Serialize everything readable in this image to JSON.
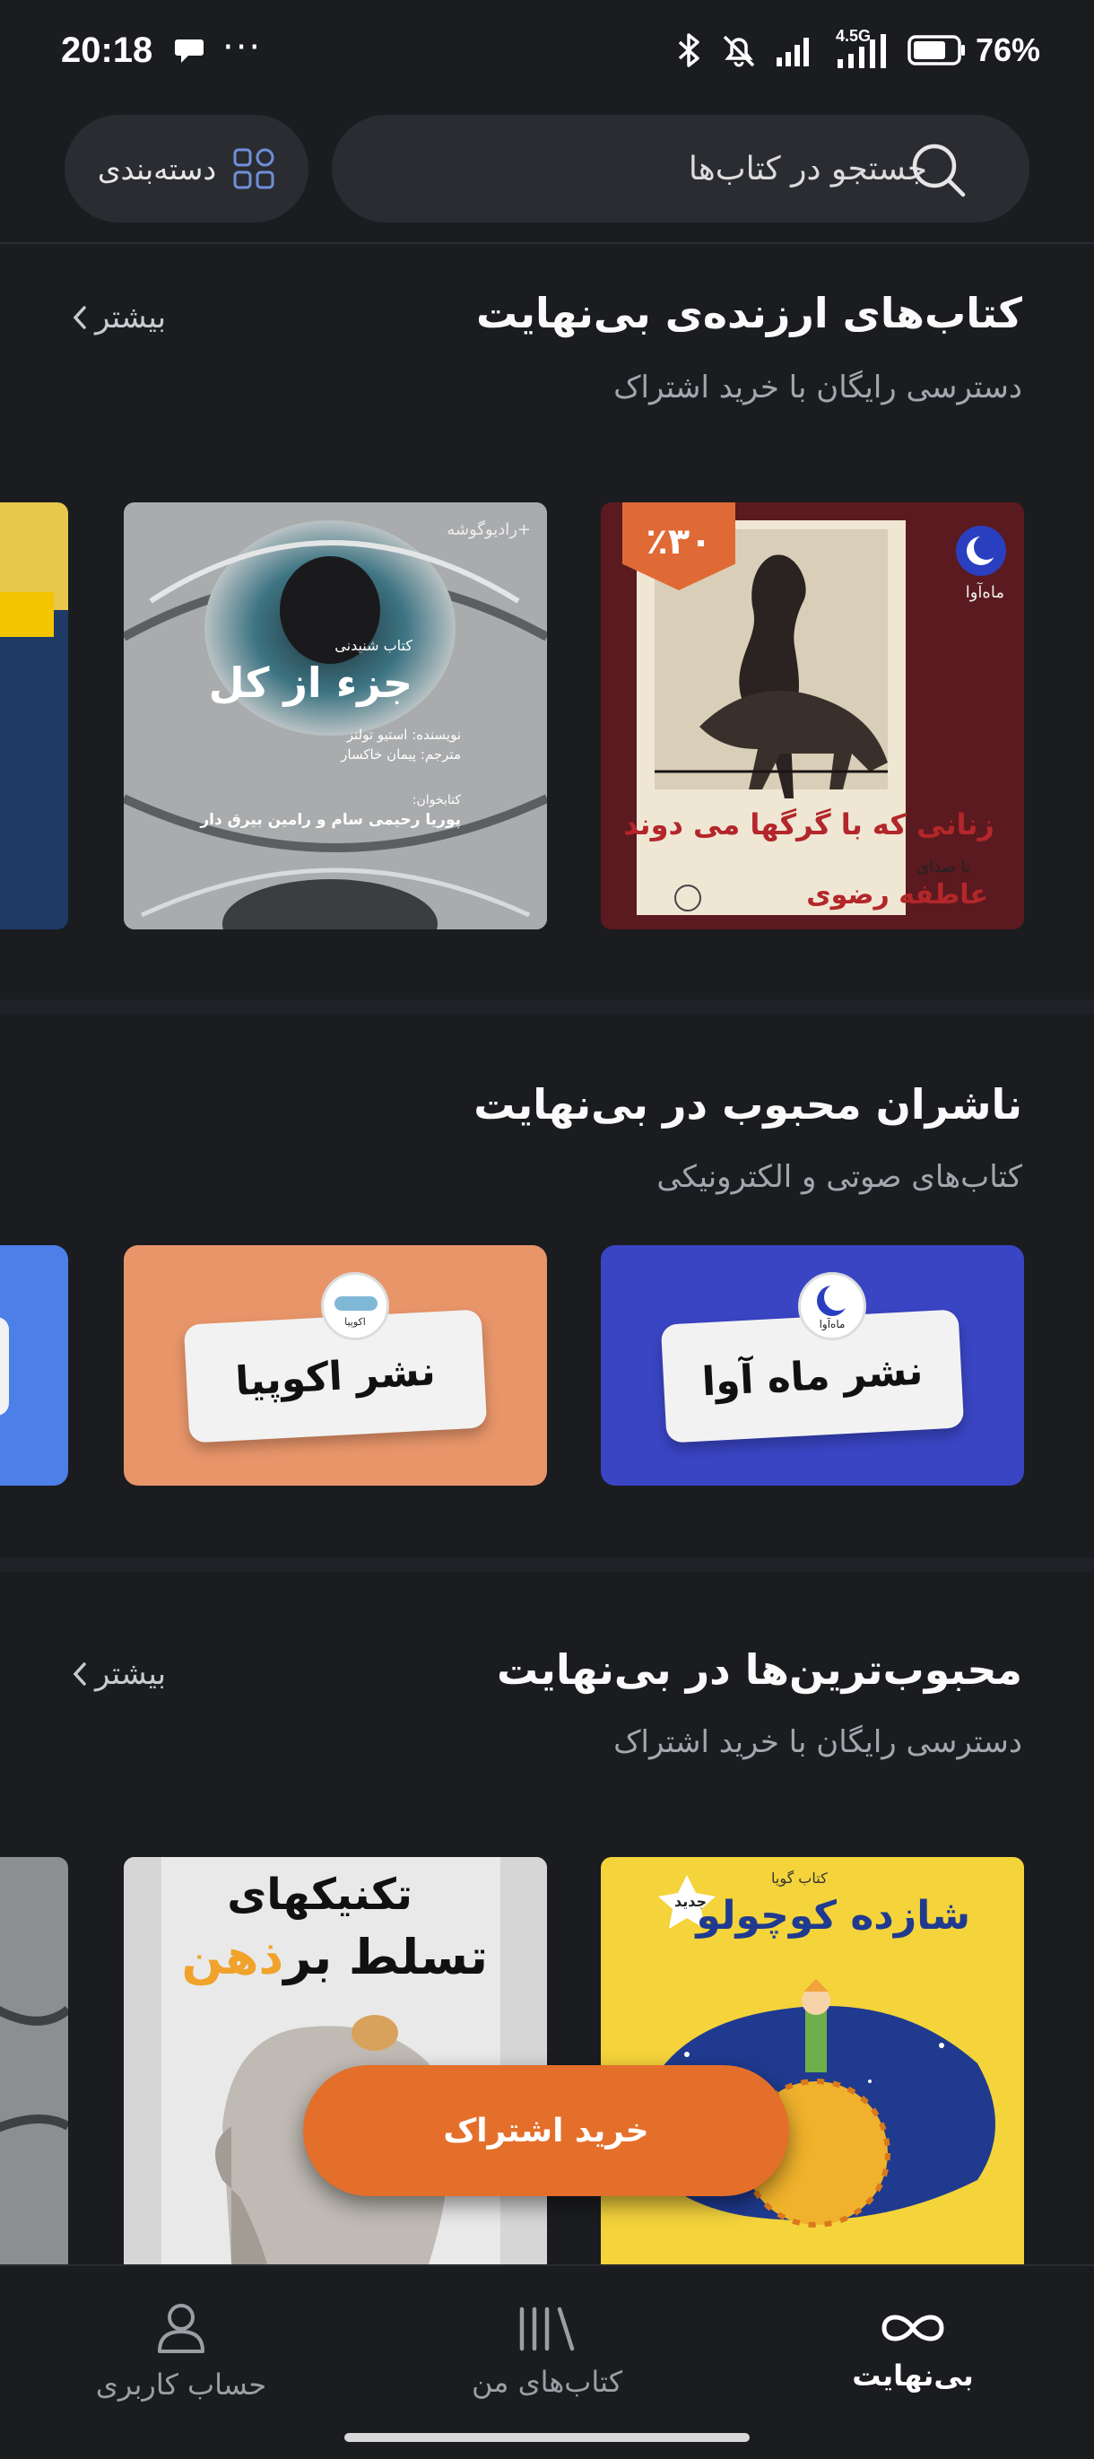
{
  "status_bar": {
    "time": "20:18",
    "dots": "···",
    "network": "4.5G",
    "battery_percent": "76%",
    "battery_level": 0.76
  },
  "header": {
    "search_placeholder": "جستجو در کتاب‌ها",
    "category_label": "دسته‌بندی"
  },
  "sections": [
    {
      "title": "کتاب‌های ارزنده‌ی بی‌نهایت",
      "subtitle": "دسترسی رایگان با خرید اشتراک",
      "more_label": "بیشتر",
      "books": [
        {
          "cover_title": "زنانی که با گرگها می دوند",
          "voice_label": "با صدای",
          "narrator": "عاطفه رضوی",
          "discount_badge": "٪۳۰",
          "publisher_mark": "ماه‌آوا"
        },
        {
          "cover_series": "کتاب شنیدنی",
          "cover_title": "جزء از کل",
          "author_line": "نویسنده: استیو تولتز",
          "translator_line": "مترجم: پیمان خاکسار",
          "readers_label": "کتابخوان:",
          "readers": "پوریا رحیمی سام و رامین بیرق دار",
          "publisher_mark": "+رادیو‌گوشه"
        }
      ]
    },
    {
      "title": "ناشران محبوب در بی‌نهایت",
      "subtitle": "کتاب‌های صوتی و الکترونیکی",
      "publishers": [
        {
          "name": "نشر ماه آوا",
          "color": "#3a45c4",
          "logo_text": "ماه‌آوا"
        },
        {
          "name": "نشر اکوپیا",
          "color": "#e8956a",
          "logo_text": "اکوپیا"
        }
      ]
    },
    {
      "title": "محبوب‌ترین‌ها در بی‌نهایت",
      "subtitle": "دسترسی رایگان با خرید اشتراک",
      "more_label": "بیشتر",
      "books": [
        {
          "cover_series": "کتاب گویا",
          "cover_title": "شازده کوچولو",
          "new_badge": "جدید"
        },
        {
          "cover_title_1": "تکنیکهای",
          "cover_title_2": "تسلط بر",
          "cover_title_3": "ذهن"
        }
      ]
    }
  ],
  "cta": {
    "label": "خرید اشتراک"
  },
  "bottom_nav": [
    {
      "label": "بی‌نهایت",
      "icon": "infinity-icon",
      "active": true
    },
    {
      "label": "کتاب‌های من",
      "icon": "library-icon",
      "active": false
    },
    {
      "label": "حساب کاربری",
      "icon": "user-icon",
      "active": false
    }
  ],
  "colors": {
    "background": "#1b1c20",
    "card_bg": "#2a2c31",
    "accent": "#e46f2b"
  }
}
